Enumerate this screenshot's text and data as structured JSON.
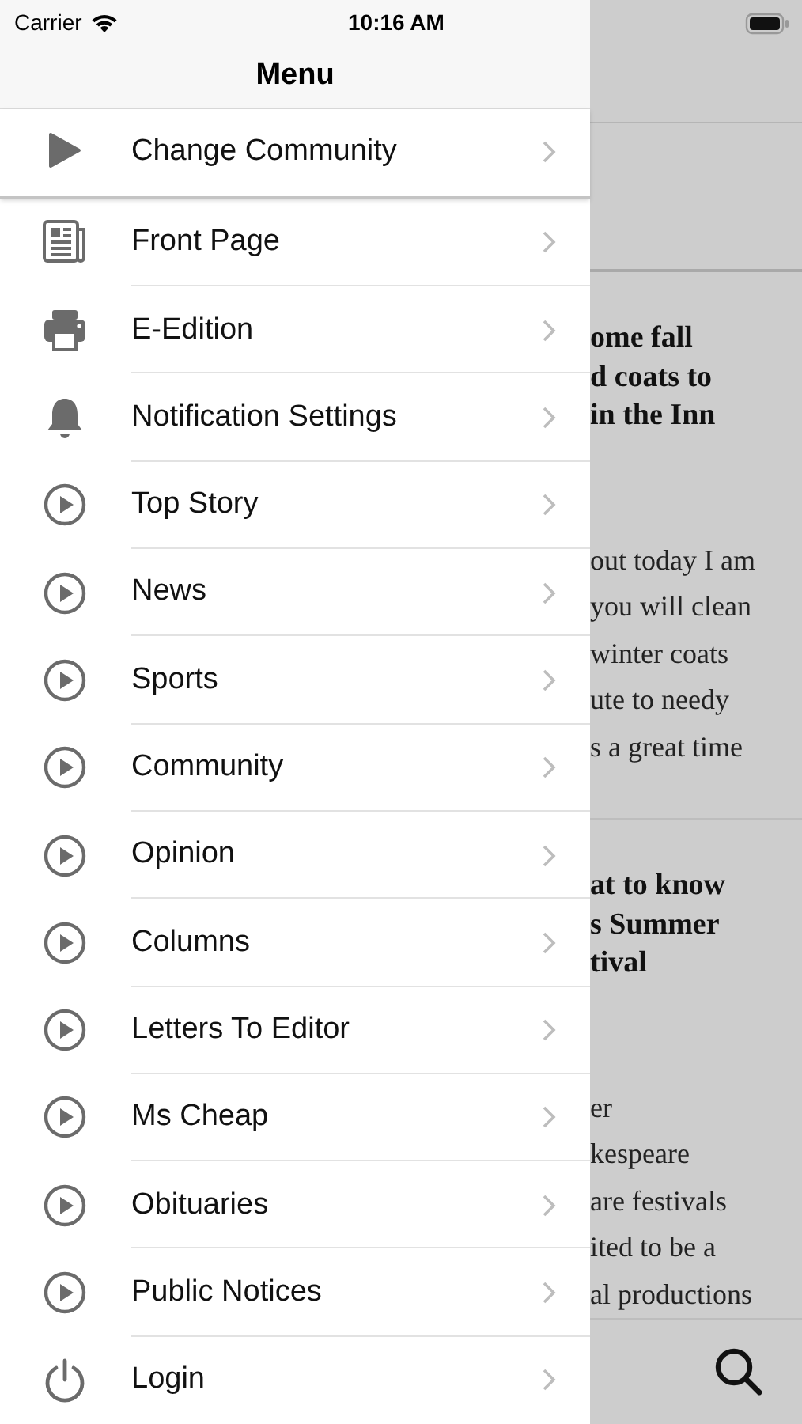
{
  "status_bar": {
    "carrier": "Carrier",
    "time": "10:16 AM"
  },
  "menu": {
    "title": "Menu",
    "items": [
      {
        "label": "Change Community",
        "kind": "play"
      },
      {
        "label": "Front Page",
        "kind": "newspaper"
      },
      {
        "label": "E-Edition",
        "kind": "printer"
      },
      {
        "label": "Notification Settings",
        "kind": "bell"
      },
      {
        "label": "Top Story",
        "kind": "play-circle"
      },
      {
        "label": "News",
        "kind": "play-circle"
      },
      {
        "label": "Sports",
        "kind": "play-circle"
      },
      {
        "label": "Community",
        "kind": "play-circle"
      },
      {
        "label": "Opinion",
        "kind": "play-circle"
      },
      {
        "label": "Columns",
        "kind": "play-circle"
      },
      {
        "label": "Letters To Editor",
        "kind": "play-circle"
      },
      {
        "label": "Ms Cheap",
        "kind": "play-circle"
      },
      {
        "label": "Obituaries",
        "kind": "play-circle"
      },
      {
        "label": "Public Notices",
        "kind": "play-circle"
      },
      {
        "label": "Login",
        "kind": "power"
      }
    ]
  },
  "background": {
    "articles": [
      {
        "headline": [
          "ome fall",
          "d coats to",
          "in the Inn"
        ],
        "body": [
          "out today I am",
          "you will clean",
          "winter coats",
          "ute to needy",
          "s a great time"
        ]
      },
      {
        "headline": [
          "at to know",
          "s Summer",
          "tival"
        ],
        "body": [
          "er",
          "kespeare",
          "are festivals",
          "ited to be a",
          "al productions"
        ]
      }
    ]
  }
}
